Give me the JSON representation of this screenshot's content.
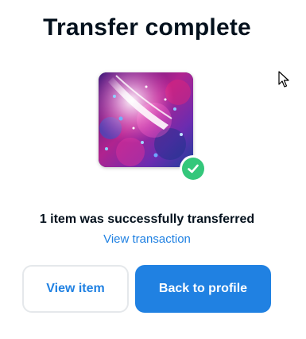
{
  "modal": {
    "title": "Transfer complete",
    "message": "1 item was successfully transferred",
    "link_label": "View transaction",
    "buttons": {
      "secondary_label": "View item",
      "primary_label": "Back to profile"
    }
  },
  "colors": {
    "accent": "#2081e2",
    "success": "#34c77b",
    "text": "#04111d",
    "border": "#e5e8eb"
  },
  "icons": {
    "badge": "check-circle-icon",
    "pointer": "mouse-cursor-icon"
  }
}
